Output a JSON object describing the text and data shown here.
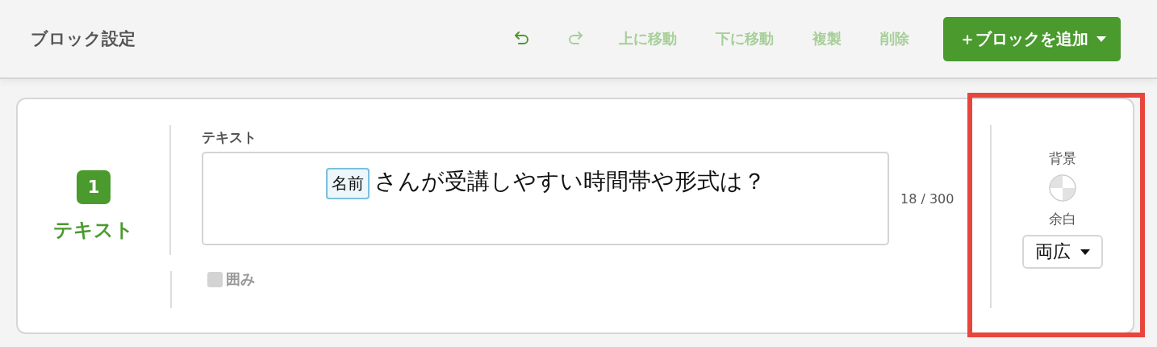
{
  "header": {
    "title": "ブロック設定",
    "toolbar": [
      {
        "kind": "undo",
        "disabled": false
      },
      {
        "kind": "redo",
        "disabled": true
      },
      {
        "kind": "text",
        "label": "上に移動",
        "disabled": true
      },
      {
        "kind": "text",
        "label": "下に移動",
        "disabled": true
      },
      {
        "kind": "text",
        "label": "複製",
        "disabled": true
      },
      {
        "kind": "text",
        "label": "削除",
        "disabled": true
      }
    ],
    "add_button": {
      "label": "＋ブロックを追加"
    }
  },
  "block": {
    "number": "1",
    "type_label": "テキスト",
    "field_label": "テキスト",
    "content": [
      {
        "kind": "tag",
        "text": "名前"
      },
      {
        "kind": "text",
        "text": "さんが受講しやすい時間帯や形式は？"
      }
    ],
    "counter": "18 / 300",
    "frame_checkbox": {
      "label": "囲み",
      "checked": false,
      "disabled": true
    },
    "background_label": "背景",
    "margin_label": "余白",
    "margin_value": "両広"
  }
}
